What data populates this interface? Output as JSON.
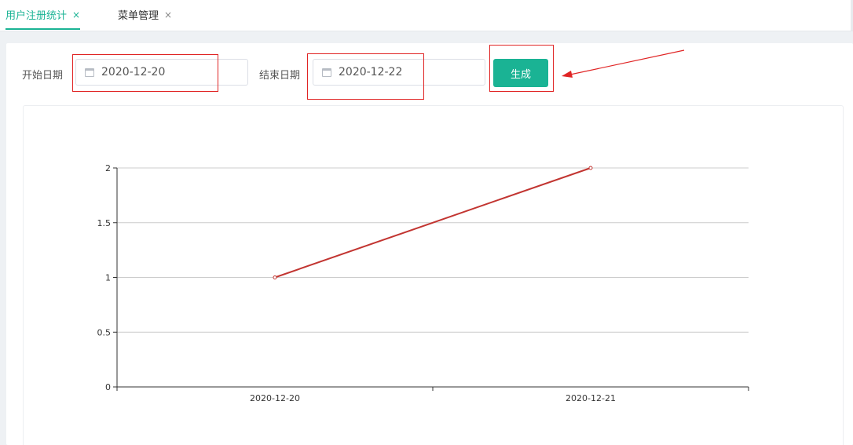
{
  "tabs": [
    {
      "label": "用户注册统计",
      "active": true
    },
    {
      "label": "菜单管理",
      "active": false
    }
  ],
  "tab_close_glyph": "×",
  "filters": {
    "start_label": "开始日期",
    "start_value": "2020-12-20",
    "end_label": "结束日期",
    "end_value": "2020-12-22",
    "generate_label": "生成"
  },
  "icons": {
    "calendar": "calendar-icon",
    "close": "close-icon"
  },
  "colors": {
    "accent": "#1ab394",
    "line": "#c23531",
    "annotation": "#e02424"
  },
  "chart_data": {
    "type": "line",
    "categories": [
      "2020-12-20",
      "2020-12-21"
    ],
    "values": [
      1,
      2
    ],
    "ylim": [
      0,
      2
    ],
    "yticks": [
      "0",
      "0.5",
      "1",
      "1.5",
      "2"
    ],
    "grid": true
  }
}
